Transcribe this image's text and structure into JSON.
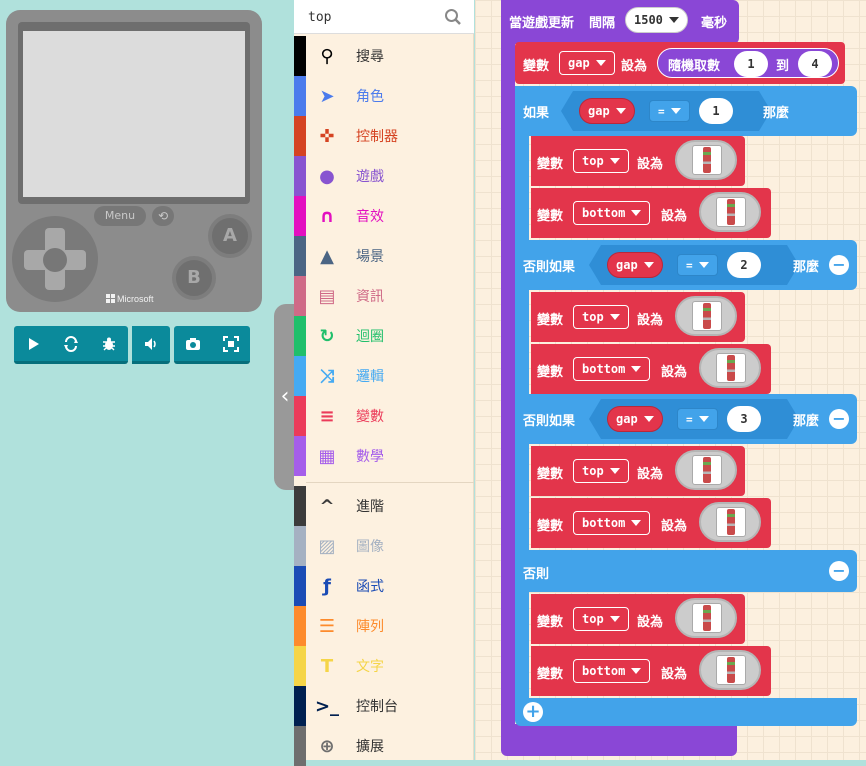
{
  "simulator": {
    "menu_label": "Menu",
    "button_a": "A",
    "button_b": "B",
    "brand": "Microsoft",
    "toolbar": [
      "play",
      "restart",
      "debug",
      "sound",
      "screenshot",
      "fullscreen"
    ]
  },
  "search": {
    "value": "top",
    "placeholder": ""
  },
  "categories": [
    {
      "label": "搜尋",
      "icon": "search-icon",
      "color": "#000000"
    },
    {
      "label": "角色",
      "icon": "paper-plane-icon",
      "color": "#4b7bec"
    },
    {
      "label": "控制器",
      "icon": "gamepad-icon",
      "color": "#d54322"
    },
    {
      "label": "遊戲",
      "icon": "circle-icon",
      "color": "#8854d0"
    },
    {
      "label": "音效",
      "icon": "headphones-icon",
      "color": "#e30fc0"
    },
    {
      "label": "場景",
      "icon": "tree-icon",
      "color": "#4b6584"
    },
    {
      "label": "資訊",
      "icon": "id-card-icon",
      "color": "#cf6a87"
    },
    {
      "label": "迴圈",
      "icon": "refresh-icon",
      "color": "#20bf6b"
    },
    {
      "label": "邏輯",
      "icon": "shuffle-icon",
      "color": "#45aaf2"
    },
    {
      "label": "變數",
      "icon": "list-icon",
      "color": "#eb3b5a"
    },
    {
      "label": "數學",
      "icon": "calculator-icon",
      "color": "#a55eea"
    },
    {
      "label": "進階",
      "icon": "chevron-up-icon",
      "color": "#3c3c3c"
    },
    {
      "label": "圖像",
      "icon": "image-icon",
      "color": "#a5b1c2"
    },
    {
      "label": "函式",
      "icon": "function-icon",
      "color": "#1b4cb5"
    },
    {
      "label": "陣列",
      "icon": "numbered-list-icon",
      "color": "#fd8b2c"
    },
    {
      "label": "文字",
      "icon": "text-icon",
      "color": "#f5d547"
    },
    {
      "label": "控制台",
      "icon": "terminal-icon",
      "color": "#002050"
    },
    {
      "label": "擴展",
      "icon": "plus-circle-icon",
      "color": "#6e6e6e"
    }
  ],
  "workspace": {
    "event": {
      "label": "當遊戲更新",
      "interval_label": "間隔",
      "interval": "1500",
      "unit": "毫秒"
    },
    "set_var": {
      "prefix": "變數",
      "var": "gap",
      "set": "設為",
      "random": "隨機取數",
      "from": "1",
      "to_label": "到",
      "to": "4"
    },
    "if_label": "如果",
    "then_label": "那麼",
    "elseif_label": "否則如果",
    "else_label": "否則",
    "eq": "=",
    "cond_var": "gap",
    "cond_values": [
      "1",
      "2",
      "3"
    ],
    "var_label": "變數",
    "set_label": "設為",
    "top_var": "top",
    "bottom_var": "bottom"
  }
}
